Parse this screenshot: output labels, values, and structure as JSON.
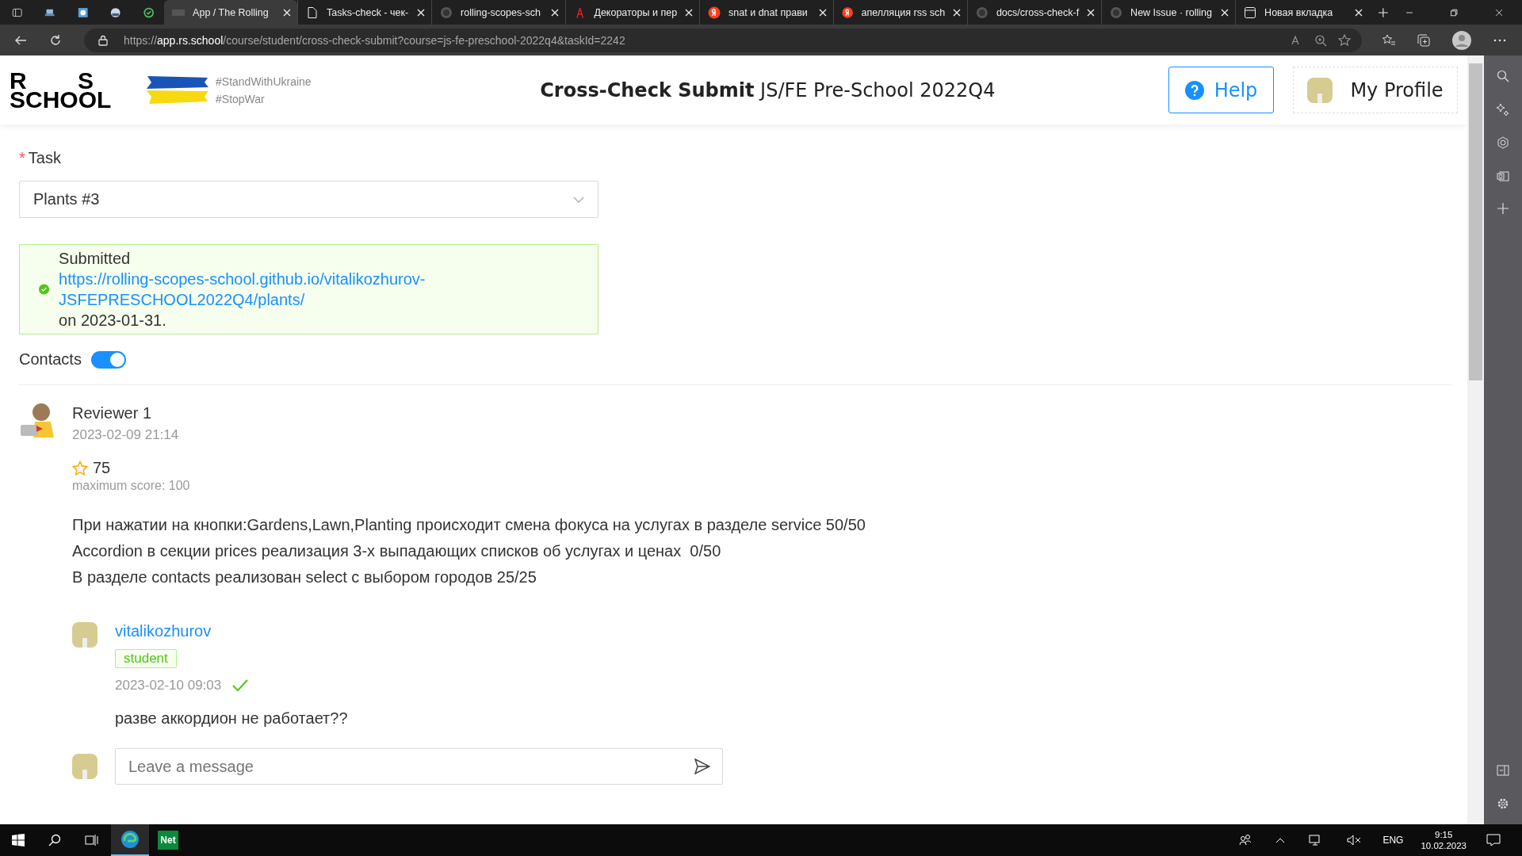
{
  "browser": {
    "tabs": [
      {
        "label": "App / The Rolling",
        "kind": "rs",
        "selected": true
      },
      {
        "label": "Tasks-check - чек-",
        "kind": "doc",
        "selected": false
      },
      {
        "label": "rolling-scopes-sch",
        "kind": "github",
        "selected": false
      },
      {
        "label": "Декораторы и пер",
        "kind": "antenna",
        "selected": false
      },
      {
        "label": "snat и dnat прави",
        "kind": "yandex",
        "selected": false
      },
      {
        "label": "апелляция rss sch",
        "kind": "yandex",
        "selected": false
      },
      {
        "label": "docs/cross-check-f",
        "kind": "github",
        "selected": false
      },
      {
        "label": "New Issue · rolling",
        "kind": "github",
        "selected": false
      },
      {
        "label": "Новая вкладка",
        "kind": "newtab",
        "selected": false
      }
    ],
    "url": "https://**app.rs.school**/course/student/cross-check-submit?course=js-fe-preschool-2022q4&taskId=2242"
  },
  "header": {
    "logo_top": "R S",
    "logo_bottom": "SCHOOL",
    "hashtags": [
      "#StandWithUkraine",
      "#StopWar"
    ],
    "title": "**Cross-Check Submit** JS/FE Pre-School 2022Q4",
    "help_button": "Help",
    "profile_button": "My Profile"
  },
  "form": {
    "required_mark": "*",
    "task_label": "Task",
    "task_value": "Plants #3",
    "alert": {
      "prefix": "Submitted ",
      "link": "https://rolling-scopes-school.github.io/vitalikozhurov-JSFEPRESCHOOL2022Q4/plants/",
      "suffix": " on 2023-01-31."
    },
    "contacts_label": "Contacts",
    "contacts_on": true
  },
  "review": {
    "author": "Reviewer 1",
    "date": "2023-02-09 21:14",
    "score": "75",
    "max_score": "maximum score: 100",
    "comment": [
      "При нажатии на кнопки:Gardens,Lawn,Planting происходит смена фокуса на услугах в разделе service 50/50",
      "Accordion в секции prices реализация 3-х выпадающих списков об услугах и ценах  0/50",
      "В разделе contacts реализован select с выбором городов 25/25"
    ]
  },
  "reply": {
    "author": "vitalikozhurov",
    "role": "student",
    "date": "2023-02-10 09:03",
    "seen": true,
    "text": "разве аккордион не работает??"
  },
  "message": {
    "placeholder": "Leave a message"
  },
  "taskbar": {
    "apps": [
      {
        "kind": "edge",
        "selected": true
      },
      {
        "kind": "net",
        "label": "Net",
        "selected": false
      }
    ],
    "language": "ENG",
    "time": "9:15",
    "date": "10.02.2023"
  }
}
